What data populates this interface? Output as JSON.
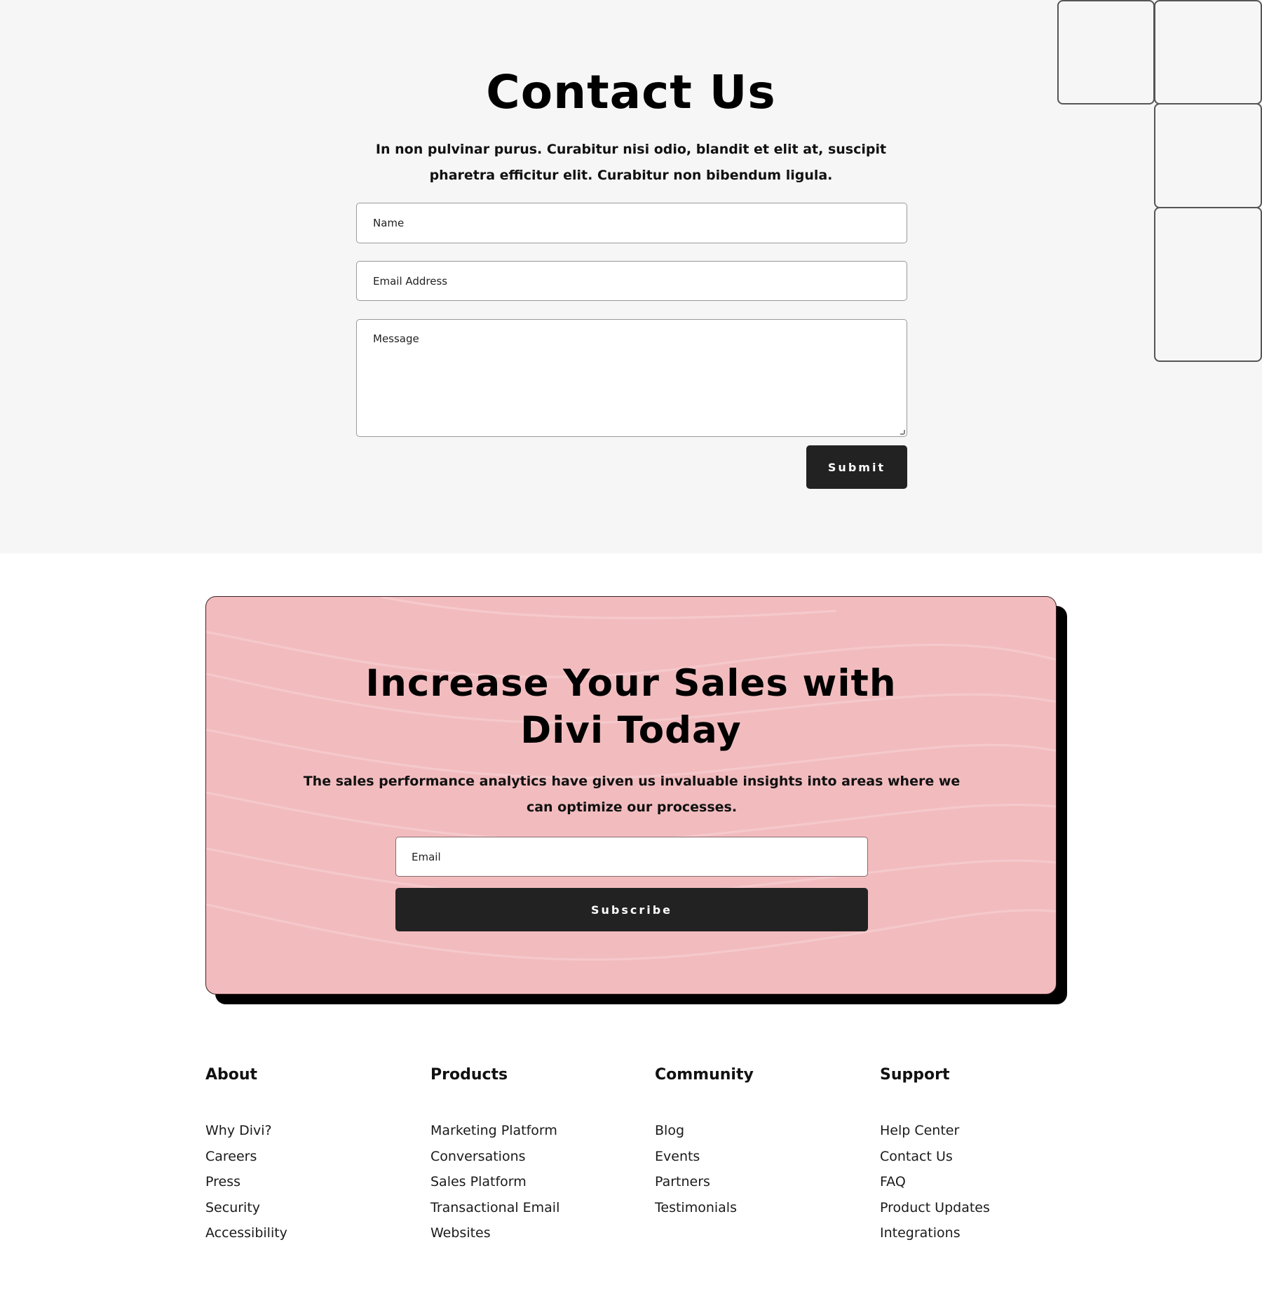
{
  "contact": {
    "title": "Contact Us",
    "description": "In non pulvinar purus. Curabitur nisi odio, blandit et elit at, suscipit pharetra efficitur elit. Curabitur non bibendum ligula.",
    "fields": {
      "name_placeholder": "Name",
      "email_placeholder": "Email Address",
      "message_placeholder": "Message"
    },
    "submit_label": "Submit"
  },
  "cta": {
    "title": "Increase Your Sales with Divi Today",
    "description": "The sales performance analytics have given us invaluable insights into areas where we can optimize our processes.",
    "email_placeholder": "Email",
    "subscribe_label": "Subscribe",
    "background_color": "#f2bcbf",
    "button_color": "#222222"
  },
  "footer": {
    "columns": [
      {
        "heading": "About",
        "links": [
          "Why Divi?",
          "Careers",
          "Press",
          "Security",
          "Accessibility"
        ]
      },
      {
        "heading": "Products",
        "links": [
          "Marketing Platform",
          "Conversations",
          "Sales Platform",
          "Transactional Email",
          "Websites"
        ]
      },
      {
        "heading": "Community",
        "links": [
          "Blog",
          "Events",
          "Partners",
          "Testimonials"
        ]
      },
      {
        "heading": "Support",
        "links": [
          "Help Center",
          "Contact Us",
          "FAQ",
          "Product Updates",
          "Integrations"
        ]
      }
    ]
  }
}
